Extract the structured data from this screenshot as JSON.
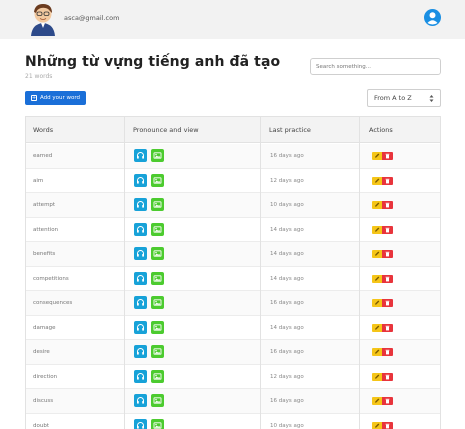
{
  "header": {
    "email": "asca@gmail.com",
    "avatar_icon": "cartoon-user-avatar",
    "profile_icon": "user-circle-icon"
  },
  "page": {
    "title": "Những từ vựng tiếng anh đã tạo",
    "count_text": "21 words"
  },
  "search": {
    "placeholder": "Search something..."
  },
  "toolbar": {
    "add_label": "Add your word"
  },
  "sort": {
    "selected": "From A to Z"
  },
  "table": {
    "columns": [
      "Words",
      "Pronounce and view",
      "Last practice",
      "Actions"
    ],
    "rows": [
      {
        "word": "earned",
        "last_practice": "16 days ago"
      },
      {
        "word": "aim",
        "last_practice": "12 days ago"
      },
      {
        "word": "attempt",
        "last_practice": "10 days ago"
      },
      {
        "word": "attention",
        "last_practice": "14 days ago"
      },
      {
        "word": "benefits",
        "last_practice": "14 days ago"
      },
      {
        "word": "competitions",
        "last_practice": "14 days ago"
      },
      {
        "word": "consequences",
        "last_practice": "16 days ago"
      },
      {
        "word": "damage",
        "last_practice": "14 days ago"
      },
      {
        "word": "desire",
        "last_practice": "16 days ago"
      },
      {
        "word": "direction",
        "last_practice": "12 days ago"
      },
      {
        "word": "discuss",
        "last_practice": "16 days ago"
      },
      {
        "word": "doubt",
        "last_practice": "10 days ago"
      }
    ]
  },
  "colors": {
    "primary": "#1a6fd8",
    "audio_button": "#17a2d8",
    "view_button": "#4ccb2f",
    "edit_button": "#f5c518",
    "delete_button": "#e8343c"
  }
}
